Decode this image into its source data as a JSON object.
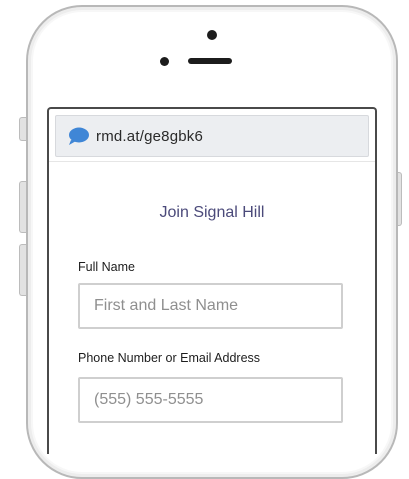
{
  "browser": {
    "url": "rmd.at/ge8gbk6",
    "url_icon": "speech-bubble-icon",
    "accent_color": "#3f86d6"
  },
  "form": {
    "title": "Join Signal Hill",
    "full_name": {
      "label": "Full Name",
      "placeholder": "First and Last Name",
      "value": ""
    },
    "contact": {
      "label": "Phone Number or Email Address",
      "placeholder": "(555) 555-5555",
      "value": ""
    }
  },
  "colors": {
    "title_text": "#4b4a7a",
    "url_bar_bg": "#eceef1",
    "input_border": "#cfcfcf"
  }
}
